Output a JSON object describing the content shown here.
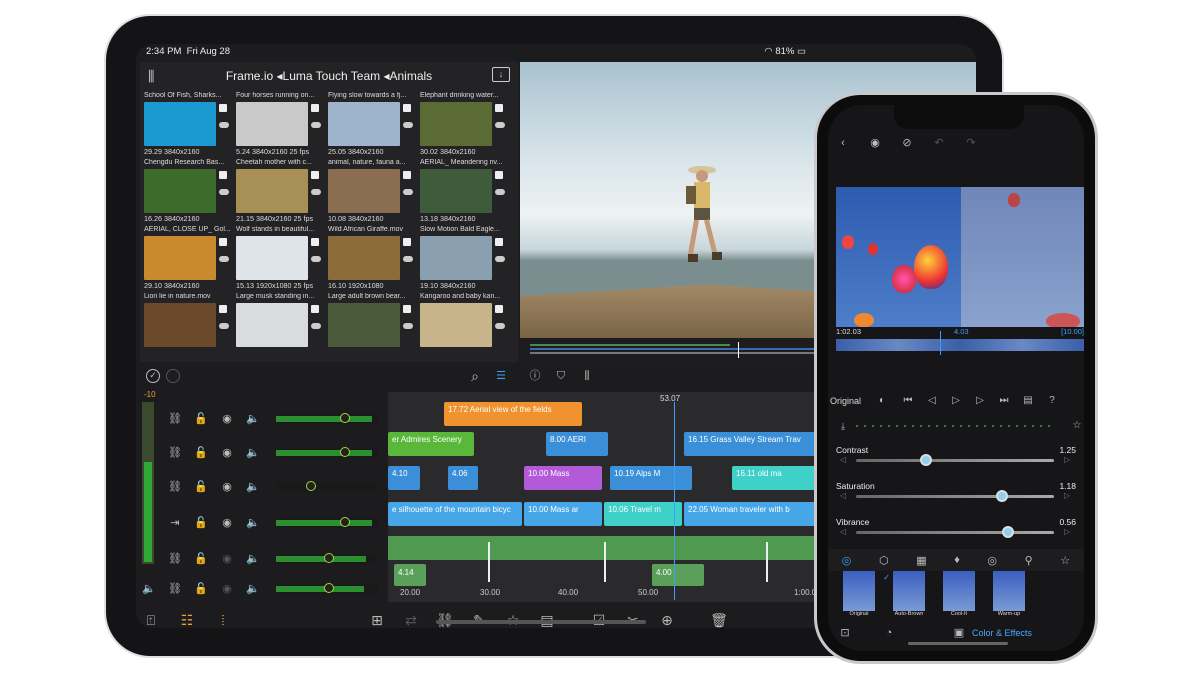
{
  "status": {
    "time": "2:34 PM",
    "date": "Fri Aug 28",
    "battery": "81%"
  },
  "library": {
    "title": "Frame.io ◂Luma Touch Team ◂Animals",
    "clips": [
      {
        "title": "School Of Fish, Sharks...",
        "meta": "29.29  3840x2160",
        "color": "#1a9ad0"
      },
      {
        "title": "Four horses running on...",
        "meta": "5.24  3840x2160  25 fps",
        "color": "#c9c9c9"
      },
      {
        "title": "Flying slow towards a fj...",
        "meta": "25.05  3840x2160",
        "color": "#9db4cc"
      },
      {
        "title": "Elephant drinking water...",
        "meta": "30.02  3840x2160",
        "color": "#5b6b34"
      },
      {
        "title": "Chengdu Research Bas...",
        "meta": "16.26  3840x2160",
        "color": "#3c6b2a"
      },
      {
        "title": "Cheetah mother with c...",
        "meta": "21.15  3840x2160  25 fps",
        "color": "#a88f55"
      },
      {
        "title": "animal, nature, fauna a...",
        "meta": "10.08  3840x2160",
        "color": "#8b6e52"
      },
      {
        "title": "AERIAL_ Meandering riv...",
        "meta": "13.18  3840x2160",
        "color": "#3f5c3a"
      },
      {
        "title": "AERIAL, CLOSE UP_ Gol...",
        "meta": "29.10  3840x2160",
        "color": "#c98a2d"
      },
      {
        "title": "Wolf stands in beautiful...",
        "meta": "15.13  1920x1080  25 fps",
        "color": "#dfe3ea"
      },
      {
        "title": "Wild African Giraffe.mov",
        "meta": "16.10  1920x1080",
        "color": "#8c6d3a"
      },
      {
        "title": "Slow Motion Bald Eagle...",
        "meta": "19.10  3840x2160",
        "color": "#8a9fb0"
      },
      {
        "title": "Lion lie in nature.mov",
        "meta": "",
        "color": "#6a4a2a"
      },
      {
        "title": "Large musk standing in...",
        "meta": "",
        "color": "#d8dcdf"
      },
      {
        "title": "Large adult brown bear...",
        "meta": "",
        "color": "#4c5a3c"
      },
      {
        "title": "Kangaroo and baby kan...",
        "meta": "",
        "color": "#c7b48a"
      }
    ]
  },
  "timeline": {
    "timecode": "53.07",
    "meter_label": "-10",
    "tracks": [
      {
        "value": "+0"
      },
      {
        "value": "+0"
      },
      {
        "value": "-18"
      },
      {
        "value": "+0"
      },
      {
        "value": "-6"
      },
      {
        "value": "-5"
      }
    ],
    "clips": {
      "c1": "17.72  Aerial view of the fields",
      "c2": "er Admires Scenery",
      "c3": "8.00  AERI",
      "c4": "16.15  Grass Valley Stream Trav",
      "c5": "4.10",
      "c6": "4.06",
      "c7": "10.00  Mass",
      "c8": "10.19  Alps M",
      "c9": "16.11  old ma",
      "c10": "e silhouette of the mountain bicyc",
      "c11": "10.00  Mass ar",
      "c12": "10.06  Travel m",
      "c13": "22.05  Woman traveler with b",
      "a1": "4.14",
      "a2": "4.00"
    },
    "ruler": [
      "20.00",
      "30.00",
      "40.00",
      "50.00",
      "1:00.00"
    ]
  },
  "phone": {
    "timecode_start": "1:02.03",
    "timecode_mid": "4.03",
    "timecode_end": "[10.00]",
    "original_label": "Original",
    "adjustments": [
      {
        "label": "Contrast",
        "value": "1.25"
      },
      {
        "label": "Saturation",
        "value": "1.18"
      },
      {
        "label": "Vibrance",
        "value": "0.56"
      }
    ],
    "presets": [
      "Original",
      "Auto-Brown",
      "Cool-It",
      "Warm-up"
    ],
    "bottom_label": "Color & Effects"
  }
}
